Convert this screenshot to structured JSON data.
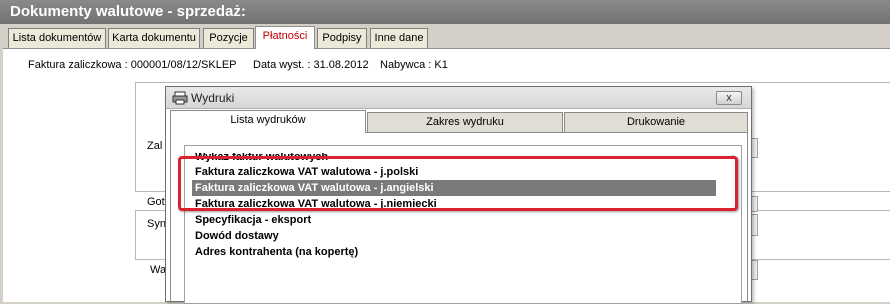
{
  "window": {
    "title": "Dokumenty walutowe - sprzedaż:"
  },
  "tabs": [
    {
      "label": "Lista dokumentów"
    },
    {
      "label": "Karta dokumentu"
    },
    {
      "label": "Pozycje"
    },
    {
      "label": "Płatności"
    },
    {
      "label": "Podpisy"
    },
    {
      "label": "Inne dane"
    }
  ],
  "info": {
    "invoice": "Faktura zaliczkowa : 000001/08/12/SKLEP",
    "date": "Data wyst. : 31.08.2012",
    "buyer": "Nabywca : K1"
  },
  "background_labels": {
    "zal": "Zal",
    "got": "Got",
    "syn": "Syn",
    "wa": "Wa"
  },
  "dialog": {
    "title": "Wydruki",
    "close_label": "x",
    "tabs": [
      {
        "label": "Lista wydruków"
      },
      {
        "label": "Zakres wydruku"
      },
      {
        "label": "Drukowanie"
      }
    ],
    "items": [
      {
        "label": "Wykaz faktur walutowych"
      },
      {
        "label": "Faktura zaliczkowa VAT walutowa - j.polski"
      },
      {
        "label": "Faktura zaliczkowa VAT walutowa - j.angielski"
      },
      {
        "label": "Faktura zaliczkowa VAT walutowa - j.niemiecki"
      },
      {
        "label": "Specyfikacja - eksport"
      },
      {
        "label": "Dowód dostawy"
      },
      {
        "label": "Adres kontrahenta (na kopertę)"
      }
    ]
  },
  "colors": {
    "highlight": "#d9232f",
    "active_tab_text": "#c00000",
    "selection": "#7a7a7a"
  }
}
